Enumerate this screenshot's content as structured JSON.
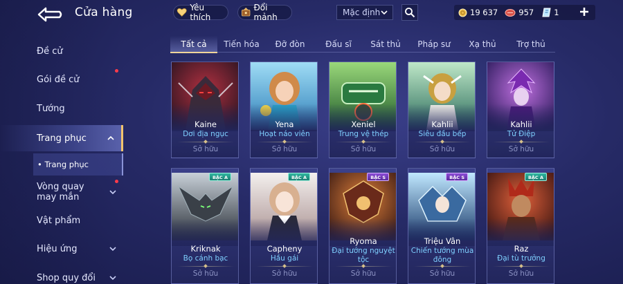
{
  "header": {
    "title": "Cửa hàng",
    "favorites_label": "Yêu thích",
    "exchange_label": "Đổi mảnh",
    "sort_value": "Mặc định"
  },
  "currency": {
    "gold": "19 637",
    "vouchers": "957",
    "tickets": "1"
  },
  "sidebar": {
    "items": [
      {
        "label": "Đề cử"
      },
      {
        "label": "Gói đề cử",
        "dot": true
      },
      {
        "label": "Tướng"
      },
      {
        "label": "Trang phục",
        "active": true
      },
      {
        "label": "Vòng quay may mắn",
        "dot": true
      },
      {
        "label": "Vật phẩm"
      },
      {
        "label": "Hiệu ứng"
      },
      {
        "label": "Shop quy đổi"
      }
    ],
    "subitem": "• Trang phục"
  },
  "tabs": [
    "Tất cả",
    "Tiến hóa",
    "Đỡ đòn",
    "Đấu sĩ",
    "Sát thủ",
    "Pháp sư",
    "Xạ thủ",
    "Trợ thủ"
  ],
  "cards": [
    {
      "hero": "Kaine",
      "skin": "Dơi địa ngục",
      "status": "Sở hữu",
      "badge": "",
      "tint": "#6b1d2a"
    },
    {
      "hero": "Yena",
      "skin": "Hoạt náo viên",
      "status": "Sở hữu",
      "badge": "",
      "tint": "#3a8fc0"
    },
    {
      "hero": "Xeniel",
      "skin": "Trung vệ thép",
      "status": "Sở hữu",
      "badge": "",
      "tint": "#2f7a3a"
    },
    {
      "hero": "Kahlii",
      "skin": "Siêu đầu bếp",
      "status": "Sở hữu",
      "badge": "",
      "tint": "#3a8a7a"
    },
    {
      "hero": "Kahlii",
      "skin": "Tử Điệp",
      "status": "Sở hữu",
      "badge": "",
      "tint": "#6a3aa0"
    },
    {
      "hero": "Kriknak",
      "skin": "Bọ cánh bạc",
      "status": "Sở hữu",
      "badge": "BẬC A",
      "tint": "#3a4a5a"
    },
    {
      "hero": "Capheny",
      "skin": "Hầu gái",
      "status": "Sở hữu",
      "badge": "BẬC A",
      "tint": "#c8b0a8"
    },
    {
      "hero": "Ryoma",
      "skin": "Đại tướng nguyệt tộc",
      "status": "Sở hữu",
      "badge": "BẬC S",
      "tint": "#8a3a20"
    },
    {
      "hero": "Triệu Vân",
      "skin": "Chiến tướng mùa đông",
      "status": "Sở hữu",
      "badge": "BẬC S",
      "tint": "#3a6aa0"
    },
    {
      "hero": "Raz",
      "skin": "Đại tù trưởng",
      "status": "Sở hữu",
      "badge": "BẬC A",
      "tint": "#8a3020"
    }
  ],
  "colors": {
    "accent_gold": "#f0d59a",
    "skin_name": "#7fd0ff",
    "notification_dot": "#ff3b4a",
    "badge_a": "#2fb7a0",
    "badge_s": "#8b4bd6"
  }
}
